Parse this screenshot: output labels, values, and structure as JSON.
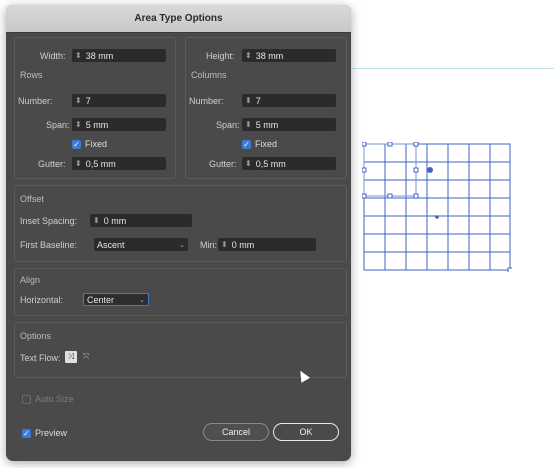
{
  "dialog": {
    "title": "Area Type Options",
    "width": {
      "label": "Width:",
      "value": "38 mm"
    },
    "height": {
      "label": "Height:",
      "value": "38 mm"
    },
    "rows": {
      "heading": "Rows",
      "number_label": "Number:",
      "number_value": "7",
      "span_label": "Span:",
      "span_value": "5 mm",
      "fixed_label": "Fixed",
      "gutter_label": "Gutter:",
      "gutter_value": "0,5 mm"
    },
    "columns": {
      "heading": "Columns",
      "number_label": "Number:",
      "number_value": "7",
      "span_label": "Span:",
      "span_value": "5 mm",
      "fixed_label": "Fixed",
      "gutter_label": "Gutter:",
      "gutter_value": "0,5 mm"
    },
    "offset": {
      "heading": "Offset",
      "inset_label": "Inset Spacing:",
      "inset_value": "0 mm",
      "baseline_label": "First Baseline:",
      "baseline_value": "Ascent",
      "min_label": "Min:",
      "min_value": "0 mm"
    },
    "align": {
      "heading": "Align",
      "horizontal_label": "Horizontal:",
      "horizontal_value": "Center"
    },
    "options": {
      "heading": "Options",
      "text_flow_label": "Text Flow:"
    },
    "auto_size_label": "Auto Size",
    "preview_label": "Preview",
    "cancel_label": "Cancel",
    "ok_label": "OK"
  },
  "colors": {
    "dialog_bg": "#4a4a4a",
    "accent": "#3b7bd6",
    "grid": "#3f63c9",
    "guide": "#bfe2ea"
  },
  "canvas": {
    "grid_rows": 7,
    "grid_cols": 7
  }
}
